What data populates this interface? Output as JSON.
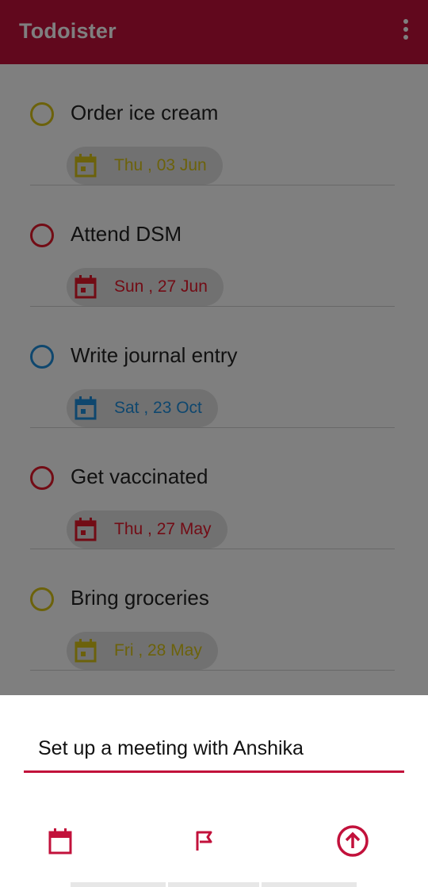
{
  "app": {
    "title": "Todoister",
    "accent": "#c2113b"
  },
  "tasks": [
    {
      "name": "Order ice cream",
      "date": "Thu , 03 Jun",
      "color": "#d8c417"
    },
    {
      "name": "Attend DSM",
      "date": "Sun , 27 Jun",
      "color": "#e5182b"
    },
    {
      "name": "Write journal entry",
      "date": "Sat , 23 Oct",
      "color": "#1f8fdd"
    },
    {
      "name": "Get vaccinated",
      "date": "Thu , 27 May",
      "color": "#e5182b"
    },
    {
      "name": "Bring groceries",
      "date": "Fri , 28 May",
      "color": "#d8c417"
    }
  ],
  "sheet": {
    "input_value": "Set up a meeting with Anshika"
  },
  "icons": {
    "menu": "more-vert-icon",
    "calendar": "calendar-icon",
    "flag": "flag-icon",
    "save": "arrow-up-circle-icon"
  }
}
